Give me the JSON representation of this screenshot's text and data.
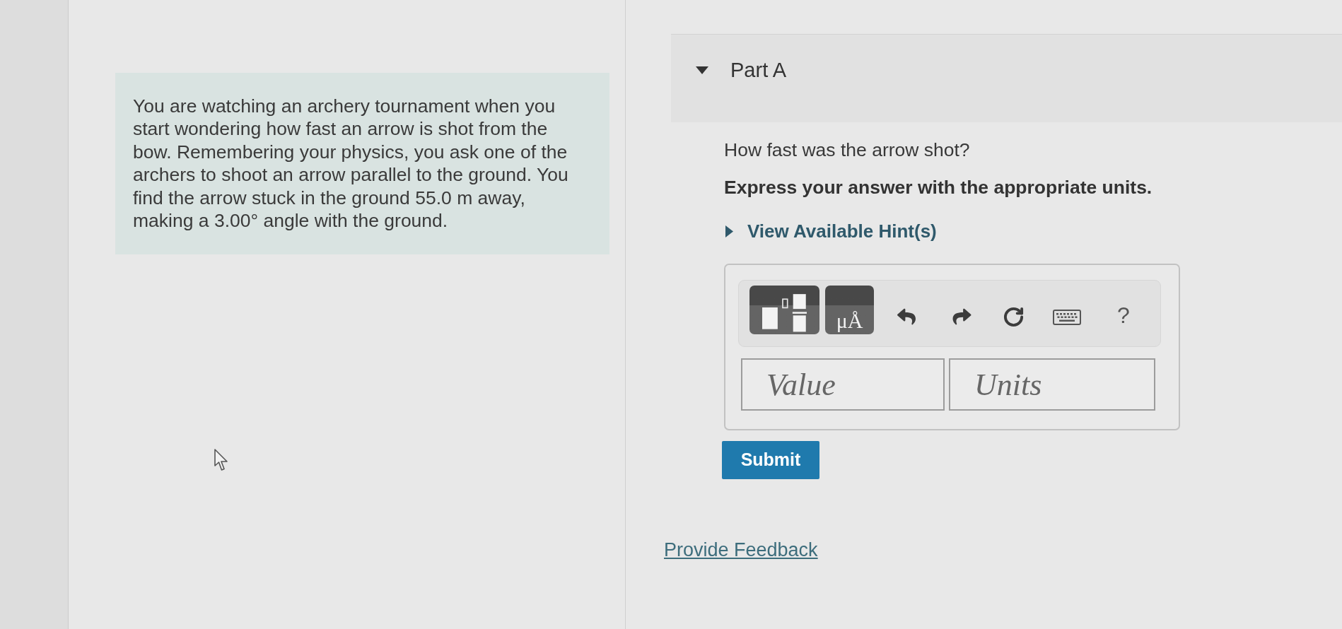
{
  "problem": {
    "text": "You are watching an archery tournament when you start wondering how fast an arrow is shot from the bow. Remembering your physics, you ask one of the archers to shoot an arrow parallel to the ground. You find the arrow stuck in the ground 55.0 m away, making a 3.00° angle with the ground."
  },
  "part": {
    "title": "Part A",
    "expanded": true
  },
  "question": {
    "prompt": "How fast was the arrow shot?",
    "instruction": "Express your answer with the appropriate units.",
    "hints": {
      "label": "View Available Hint(s)",
      "expanded": false
    }
  },
  "answer": {
    "toolbar": [
      {
        "kind": "templates"
      },
      {
        "kind": "units",
        "label": "μÅ"
      },
      {
        "kind": "undo"
      },
      {
        "kind": "redo"
      },
      {
        "kind": "reset"
      },
      {
        "kind": "keyboard"
      },
      {
        "kind": "help",
        "label": "?"
      }
    ],
    "value": {
      "placeholder": "Value"
    },
    "units": {
      "placeholder": "Units"
    }
  },
  "submit": {
    "label": "Submit"
  },
  "feedback": {
    "label": "Provide Feedback"
  }
}
